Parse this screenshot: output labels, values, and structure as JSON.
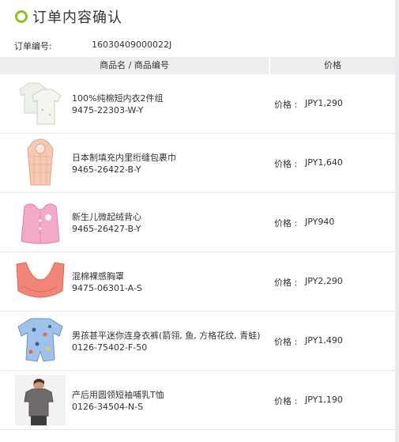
{
  "page_title": "订单内容确认",
  "order": {
    "label": "订单编号:",
    "number": "16030409000022J"
  },
  "table": {
    "col_product": "商品名 / 商品编号",
    "col_price": "价格"
  },
  "price_label": "价格 :",
  "items": [
    {
      "name": "100%纯棉短内衣2件组",
      "code": "9475-22303-W-Y",
      "price": "JPY1,290",
      "image": "white-baby-undershirts"
    },
    {
      "name": "日本制填充内里绗缝包裹巾",
      "code": "9465-26422-B-Y",
      "price": "JPY1,640",
      "image": "peach-quilted-swaddle"
    },
    {
      "name": "新生儿微起绒背心",
      "code": "9465-26427-B-Y",
      "price": "JPY940",
      "image": "pink-fleece-vest"
    },
    {
      "name": "混棉裸感胸罩",
      "code": "9475-06301-A-S",
      "price": "JPY2,290",
      "image": "coral-bra"
    },
    {
      "name": "男孩甚平迷你连身衣裤(箭翎, 鱼, 方格花纹, 青蛙)",
      "code": "0126-75402-F-50",
      "price": "JPY1,490",
      "image": "blue-print-romper"
    },
    {
      "name": "产后用圆领短袖哺乳T恤",
      "code": "0126-34504-N-S",
      "price": "JPY1,190",
      "image": "nursing-tshirt-model"
    }
  ],
  "colors": {
    "accent": "#8dc21f",
    "header_bg": "#eeeeee",
    "divider": "#e6e6e6"
  }
}
